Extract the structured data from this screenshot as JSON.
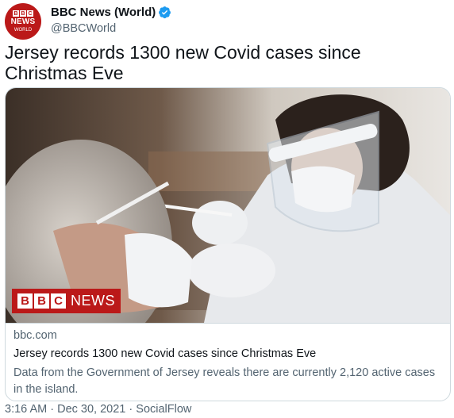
{
  "account": {
    "avatar_text": "BBC NEWS WORLD",
    "name": "BBC News (World)",
    "handle": "@BBCWorld",
    "verified_icon": "verified-badge-icon",
    "colors": {
      "brand": "#bb1919",
      "verified": "#1d9bf0"
    }
  },
  "tweet": {
    "text": "Jersey records 1300 new Covid cases since Christmas Eve"
  },
  "card": {
    "image_badge": "BBC NEWS",
    "domain": "bbc.com",
    "title": "Jersey records 1300 new Covid cases since Christmas Eve",
    "description": "Data from the Government of Jersey reveals there are currently 2,120 active cases in the island."
  },
  "meta": {
    "time": "3:16 AM",
    "date": "Dec 30, 2021",
    "source": "SocialFlow",
    "separator": "·"
  }
}
